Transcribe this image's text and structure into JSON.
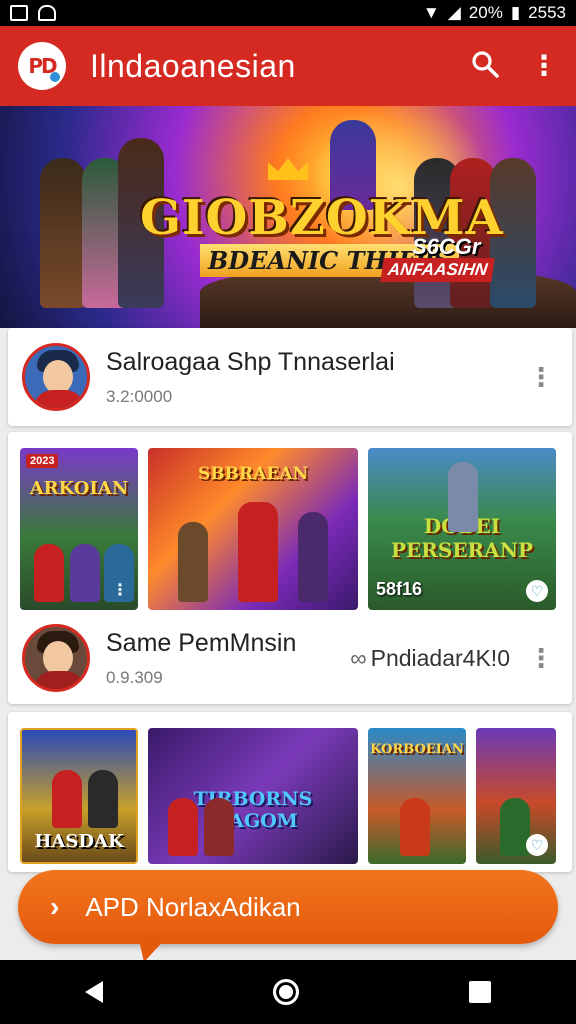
{
  "status_bar": {
    "battery": "20%",
    "time": "2553"
  },
  "app_bar": {
    "logo_text": "PD",
    "title": "Ilndaoanesian"
  },
  "banner": {
    "title": "GIOBZOKMA",
    "subtitle": "BDEANIC THIE9S",
    "tag_top": "S6CGr",
    "tag_bottom": "ANFAASIHN"
  },
  "featured": {
    "title": "Salroagaa Shp Tnnaserlai",
    "subtitle": "3.2:0000"
  },
  "row_one": {
    "tiles": [
      {
        "label": "ARKOIAN",
        "badge": "2023"
      },
      {
        "label": "SBBRAEAN"
      },
      {
        "label": "DOBEI PERSERANP",
        "corner_text": "58f16"
      }
    ],
    "title": "Same PemMnsin",
    "subtitle": "0.9.309",
    "meta": "Pndiadar4K!0"
  },
  "row_two": {
    "tiles": [
      {
        "label": "HASDAK"
      },
      {
        "label": "TIRBORNS MAGOM"
      },
      {
        "label": "KORBOEIAN"
      },
      {
        "label": ""
      }
    ]
  },
  "cta": {
    "label": "APD NorlaxAdikan"
  },
  "colors": {
    "app_bar": "#d42a22",
    "cta": "#ee6a16"
  }
}
